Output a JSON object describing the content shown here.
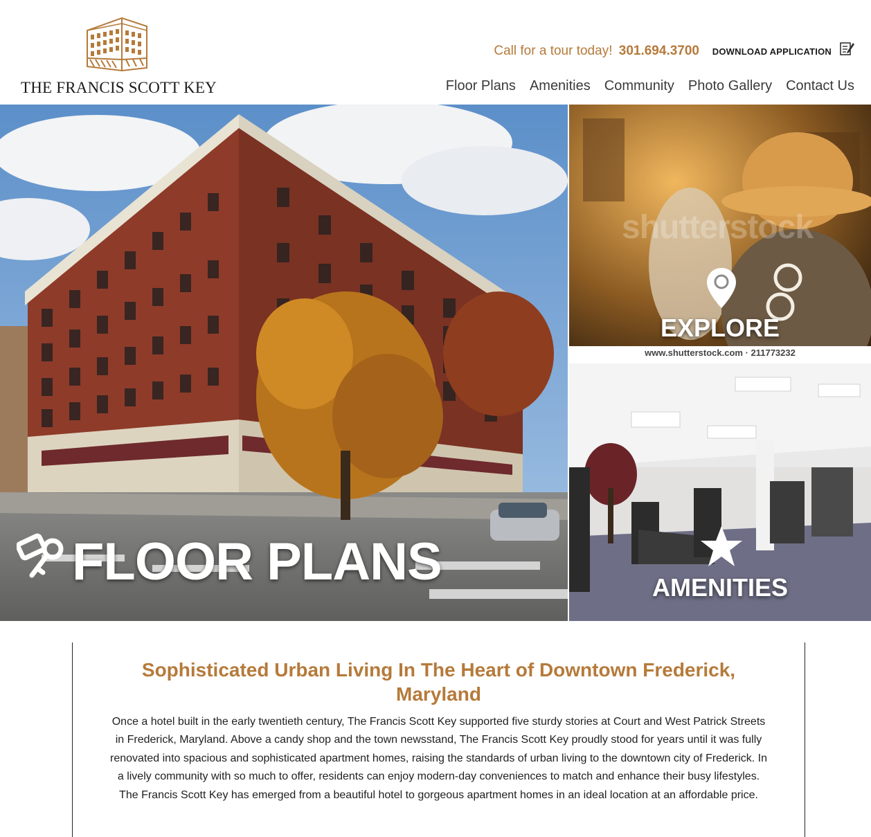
{
  "brand": {
    "name": "THE FRANCIS SCOTT KEY",
    "accent_color": "#b57a3a"
  },
  "header": {
    "tour_text": "Call for a tour today!",
    "phone": "301.694.3700",
    "download_label": "DOWNLOAD APPLICATION",
    "download_icon": "edit-document-icon"
  },
  "nav": {
    "items": [
      {
        "label": "Floor Plans"
      },
      {
        "label": "Amenities"
      },
      {
        "label": "Community"
      },
      {
        "label": "Photo Gallery"
      },
      {
        "label": "Contact Us"
      }
    ]
  },
  "hero": {
    "floor_plans": {
      "label": "FLOOR PLANS",
      "icon": "key-icon"
    },
    "explore": {
      "label": "EXPLORE",
      "icon": "map-pin-icon",
      "watermark": "shutterstock",
      "caption": "www.shutterstock.com · 211773232"
    },
    "amenities": {
      "label": "AMENITIES",
      "icon": "star-icon"
    }
  },
  "content": {
    "heading": "Sophisticated Urban Living In The Heart of Downtown Frederick, Maryland",
    "body": "Once a hotel built in the early twentieth century, The Francis Scott Key supported five sturdy stories at Court and West Patrick Streets in Frederick, Maryland. Above a candy shop and the town newsstand, The Francis Scott Key proudly stood for years until it was fully renovated into spacious and sophisticated apartment homes, raising the standards of urban living to the downtown city of Frederick. In a lively community with so much to offer, residents can enjoy modern-day conveniences to match and enhance their busy lifestyles. The Francis Scott Key has emerged from a beautiful hotel to gorgeous apartment homes in an ideal location at an affordable price."
  }
}
